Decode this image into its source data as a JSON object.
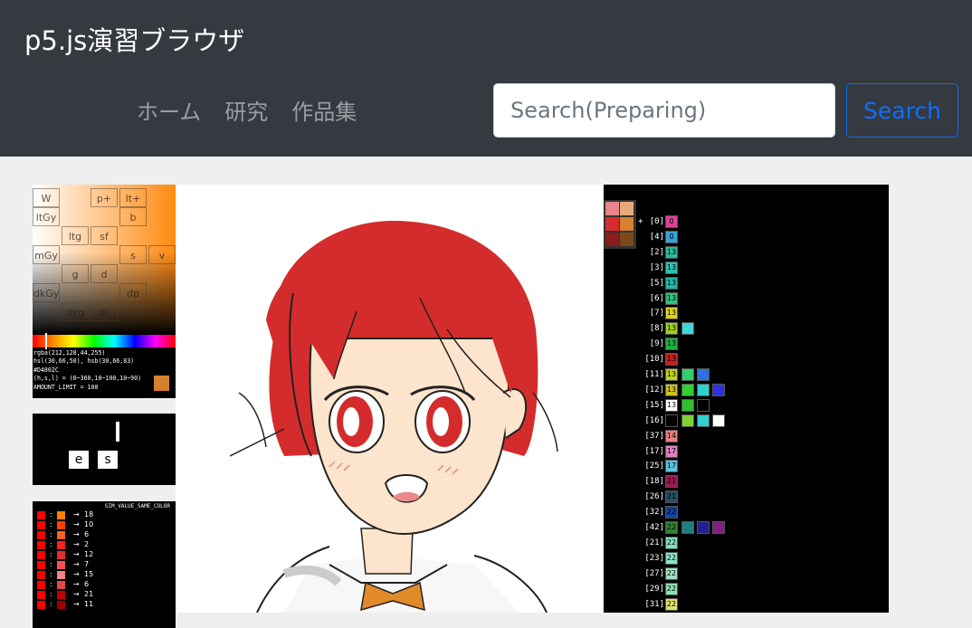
{
  "brand": "p5.js演習ブラウザ",
  "nav": [
    "ホーム",
    "研究",
    "作品集"
  ],
  "search": {
    "placeholder": "Search(Preparing)",
    "button": "Search"
  },
  "color_picker": {
    "tones": [
      "W",
      "p+",
      "lt+",
      "ltGy",
      "b",
      "ltg",
      "sf",
      "mGy",
      "s",
      "v",
      "g",
      "d",
      "dkGy",
      "dp",
      "dkg",
      "dk"
    ],
    "lines": [
      "rgba(212,128,44,255)",
      "hsl(30,66,50), hsb(30,66,83)",
      "#D4802C",
      "(h,s,l) = (0~360,10~100,10~90)",
      "AMOUNT_LIMIT = 100"
    ],
    "swatch": "#D4802C"
  },
  "typing": {
    "keys": [
      "e",
      "s"
    ]
  },
  "same_color": {
    "title": "SIM_VALUE_SAME_COLOR",
    "rows": [
      {
        "c1": "#ff0000",
        "c2": "#ff8000",
        "n": "18"
      },
      {
        "c1": "#ff0000",
        "c2": "#ff4000",
        "n": "10"
      },
      {
        "c1": "#ff0000",
        "c2": "#ff6020",
        "n": "6"
      },
      {
        "c1": "#ff0000",
        "c2": "#ff2020",
        "n": "2"
      },
      {
        "c1": "#ff0000",
        "c2": "#e03030",
        "n": "12"
      },
      {
        "c1": "#ff0000",
        "c2": "#ff5050",
        "n": "7"
      },
      {
        "c1": "#ff0000",
        "c2": "#ff8080",
        "n": "15"
      },
      {
        "c1": "#ff0000",
        "c2": "#e04848",
        "n": "6"
      },
      {
        "c1": "#ff0000",
        "c2": "#c00000",
        "n": "21"
      },
      {
        "c1": "#ff0000",
        "c2": "#a00000",
        "n": "11"
      }
    ]
  },
  "palette_list": {
    "top_swatches": [
      "#e8848a",
      "#e8a878",
      "#d42c2c",
      "#d4802c",
      "#8a1c1c",
      "#7a4a1c"
    ],
    "plus": "+",
    "rows": [
      {
        "label": "[0]",
        "n": "0",
        "c": "#e0409a",
        "ex": []
      },
      {
        "label": "[4]",
        "n": "0",
        "c": "#3aa0d8",
        "ex": []
      },
      {
        "label": "[2]",
        "n": "13",
        "c": "#2ab8a0",
        "ex": []
      },
      {
        "label": "[3]",
        "n": "13",
        "c": "#30c0b0",
        "ex": []
      },
      {
        "label": "[5]",
        "n": "13",
        "c": "#20b8a8",
        "ex": []
      },
      {
        "label": "[6]",
        "n": "13",
        "c": "#30c080",
        "ex": []
      },
      {
        "label": "[7]",
        "n": "13",
        "c": "#e0d020",
        "ex": []
      },
      {
        "label": "[8]",
        "n": "13",
        "c": "#a0d020",
        "ex": [
          "#40d8d8"
        ]
      },
      {
        "label": "[9]",
        "n": "13",
        "c": "#20b040",
        "ex": []
      },
      {
        "label": "[10]",
        "n": "13",
        "c": "#c02020",
        "ex": []
      },
      {
        "label": "[11]",
        "n": "13",
        "c": "#c0d020",
        "ex": [
          "#30d070",
          "#3070e0"
        ]
      },
      {
        "label": "[12]",
        "n": "13",
        "c": "#d0c020",
        "ex": [
          "#30d030",
          "#30d0d0",
          "#3030e0"
        ]
      },
      {
        "label": "[15]",
        "n": "13",
        "c": "#ffffff",
        "ex": [
          "#30c030",
          "#000000"
        ]
      },
      {
        "label": "[16]",
        "n": "",
        "c": "#000000",
        "ex": [
          "#80d030",
          "#30d0d0",
          "#ffffff"
        ]
      },
      {
        "label": "[37]",
        "n": "14",
        "c": "#e88080",
        "ex": []
      },
      {
        "label": "[17]",
        "n": "17",
        "c": "#e080c0",
        "ex": []
      },
      {
        "label": "[25]",
        "n": "17",
        "c": "#60c0e0",
        "ex": []
      },
      {
        "label": "[18]",
        "n": "21",
        "c": "#a01850",
        "ex": []
      },
      {
        "label": "[26]",
        "n": "21",
        "c": "#205060",
        "ex": []
      },
      {
        "label": "[32]",
        "n": "22",
        "c": "#1840a0",
        "ex": []
      },
      {
        "label": "[42]",
        "n": "22",
        "c": "#308030",
        "ex": [
          "#208080",
          "#202090",
          "#802080"
        ]
      },
      {
        "label": "[21]",
        "n": "22",
        "c": "#80e0c0",
        "ex": []
      },
      {
        "label": "[23]",
        "n": "22",
        "c": "#90e0d0",
        "ex": []
      },
      {
        "label": "[27]",
        "n": "22",
        "c": "#a0e0c0",
        "ex": []
      },
      {
        "label": "[29]",
        "n": "22",
        "c": "#90e0b0",
        "ex": []
      },
      {
        "label": "[31]",
        "n": "22",
        "c": "#e0e070",
        "ex": []
      }
    ]
  }
}
